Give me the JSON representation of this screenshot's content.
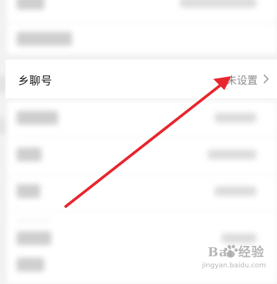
{
  "settings": {
    "focused_row": {
      "label": "乡聊号",
      "value": "未设置"
    }
  },
  "watermark": {
    "brand": "Bai 经验",
    "url": "jingyan.baidu.com"
  },
  "colors": {
    "arrow": "#e8262e",
    "row_bg": "#ffffff",
    "page_bg": "#f2f2f2",
    "value_text": "#8a8a8a"
  }
}
